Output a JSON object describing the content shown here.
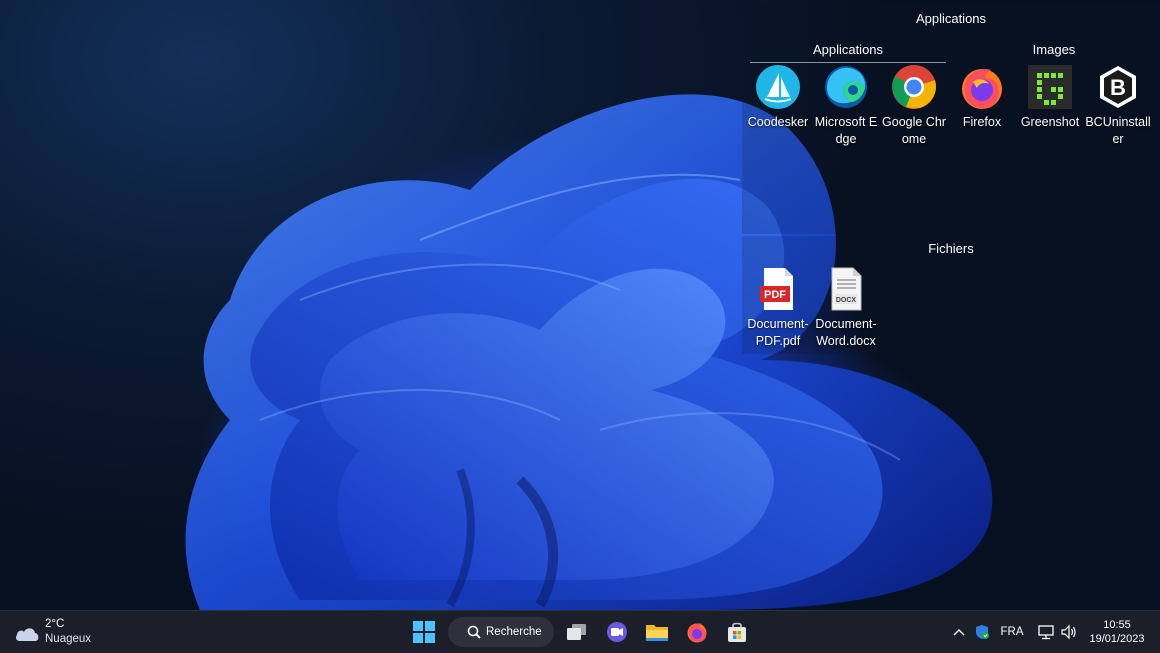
{
  "fences": {
    "applications": {
      "title": "Applications",
      "subtabs": {
        "apps": "Applications",
        "images": "Images"
      },
      "icons": [
        {
          "label": "Coodesker",
          "icon": "coodesker-icon"
        },
        {
          "label": "Microsoft Edge",
          "icon": "edge-icon"
        },
        {
          "label": "Google Chrome",
          "icon": "chrome-icon"
        },
        {
          "label": "Firefox",
          "icon": "firefox-icon"
        },
        {
          "label": "Greenshot",
          "icon": "greenshot-icon"
        },
        {
          "label": "BCUninstaller",
          "icon": "bcuninstaller-icon"
        }
      ]
    },
    "files": {
      "title": "Fichiers",
      "icons": [
        {
          "label": "Document-PDF.pdf",
          "icon": "pdf-file-icon",
          "badge": "PDF"
        },
        {
          "label": "Document-Word.docx",
          "icon": "docx-file-icon",
          "badge": "DOCX"
        }
      ]
    }
  },
  "taskbar": {
    "weather": {
      "temp": "2°C",
      "condition": "Nuageux"
    },
    "search_label": "Recherche",
    "language": "FRA",
    "time": "10:55",
    "date": "19/01/2023"
  },
  "colors": {
    "taskbar_bg": "#1b1f2a",
    "accent_blue": "#2f6bff",
    "win_logo": "#4cc2ff"
  }
}
